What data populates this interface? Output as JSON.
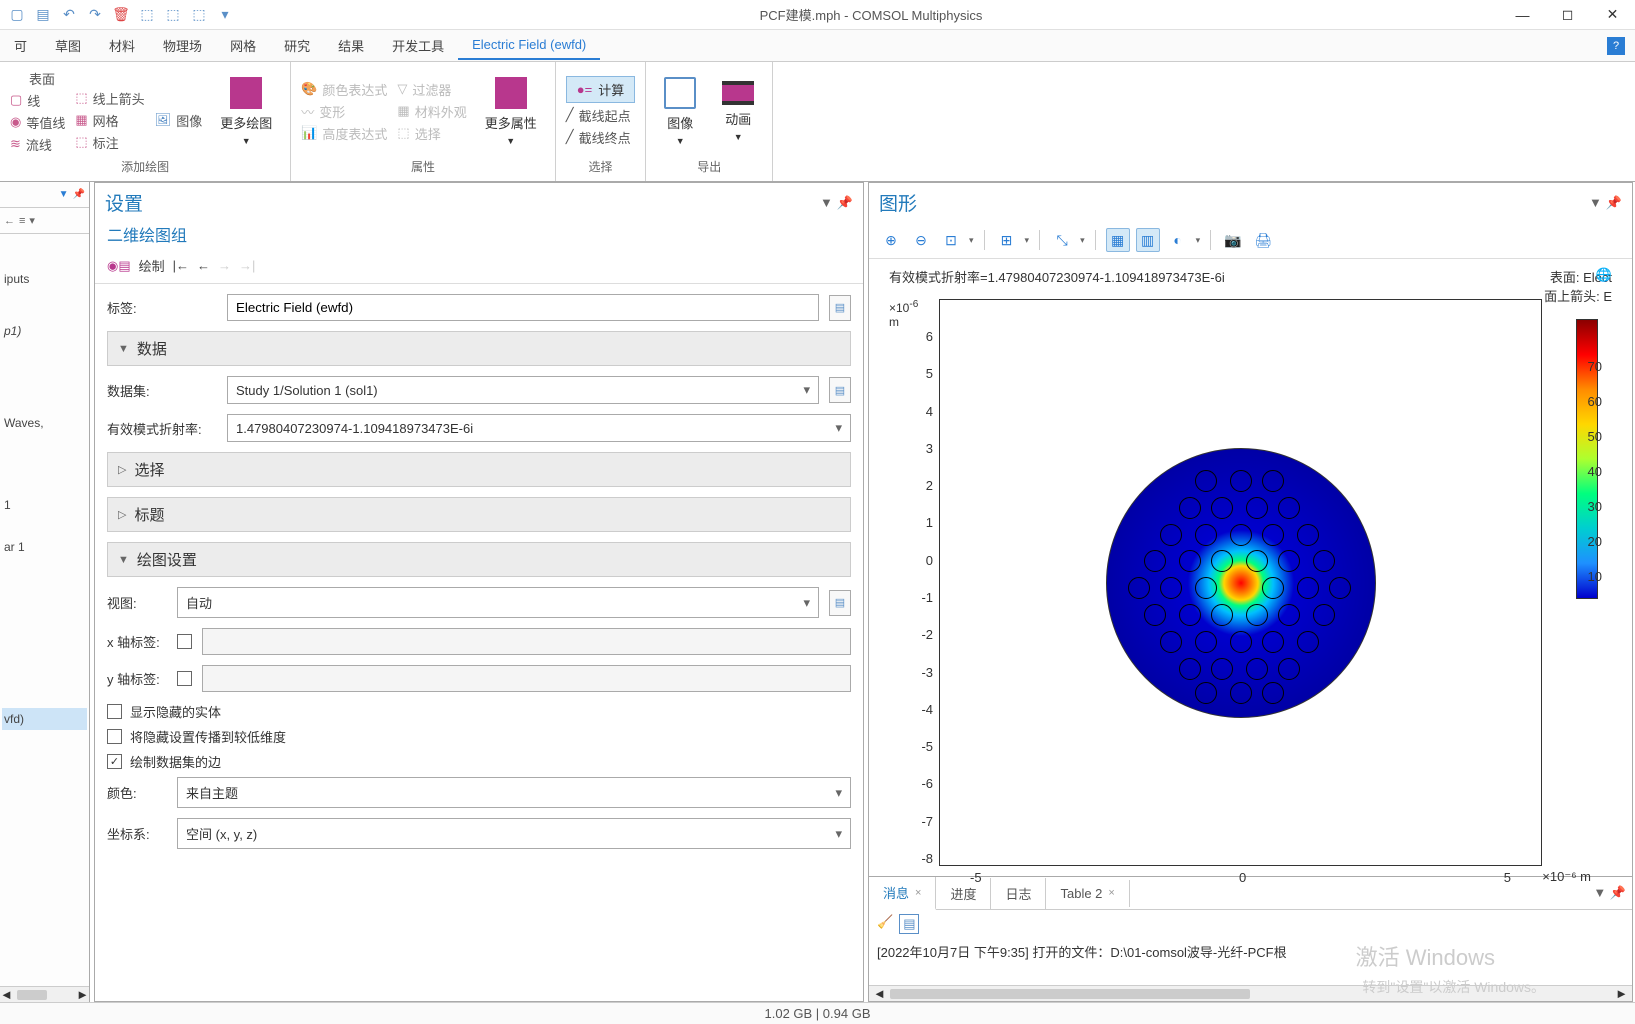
{
  "title": "PCF建模.mph - COMSOL Multiphysics",
  "menubar": [
    "可",
    "草图",
    "材料",
    "物理场",
    "网格",
    "研究",
    "结果",
    "开发工具",
    "Electric Field (ewfd)"
  ],
  "ribbon": {
    "group1": {
      "label": "添加绘图",
      "left": "表面",
      "items": [
        [
          "线",
          "线上箭头",
          "图像"
        ],
        [
          "等值线",
          "网格",
          ""
        ],
        [
          "流线",
          "标注",
          ""
        ]
      ],
      "big": "更多绘图"
    },
    "group2": {
      "label": "属性",
      "items": [
        [
          "颜色表达式",
          "过滤器"
        ],
        [
          "变形",
          "材料外观"
        ],
        [
          "高度表达式",
          "选择"
        ]
      ],
      "big": "更多属性"
    },
    "group3": {
      "label": "选择",
      "compute": "计算",
      "start": "截线起点",
      "end": "截线终点"
    },
    "group4": {
      "label": "导出",
      "img": "图像",
      "anim": "动画"
    }
  },
  "left_items": [
    "iputs",
    "p1)",
    "Waves,",
    "1",
    "ar 1",
    "vfd)"
  ],
  "settings": {
    "title": "设置",
    "subtitle": "二维绘图组",
    "plot_label": "绘制",
    "tag_label": "标签:",
    "tag_value": "Electric Field (ewfd)",
    "data_section": "数据",
    "dataset_label": "数据集:",
    "dataset_value": "Study 1/Solution 1 (sol1)",
    "refidx_label": "有效模式折射率:",
    "refidx_value": "1.47980407230974-1.109418973473E-6i",
    "select_section": "选择",
    "title_section": "标题",
    "plot_settings_section": "绘图设置",
    "view_label": "视图:",
    "view_value": "自动",
    "xlabel": "x 轴标签:",
    "ylabel": "y 轴标签:",
    "show_hidden": "显示隐藏的实体",
    "propagate": "将隐藏设置传播到较低维度",
    "plot_edges": "绘制数据集的边",
    "color_label": "颜色:",
    "color_value": "来自主题",
    "coord_label": "坐标系:",
    "coord_value": "空间 (x, y, z)"
  },
  "graphics": {
    "title": "图形",
    "info_left": "有效模式折射率=1.47980407230974-1.109418973473E-6i",
    "info_right1": "表面: Elect",
    "info_right2": "面上箭头: E",
    "y_unit_top": "×10",
    "y_unit_exp": "-6",
    "y_unit_m": "m",
    "x_unit": "×10⁻⁶ m"
  },
  "chart_data": {
    "type": "heatmap",
    "title": "有效模式折射率=1.47980407230974-1.109418973473E-6i",
    "xlabel": "×10⁻⁶ m",
    "ylabel": "×10⁻⁶ m",
    "x_ticks": [
      -5,
      0,
      5
    ],
    "y_ticks": [
      -8,
      -7,
      -6,
      -5,
      -4,
      -3,
      -2,
      -1,
      0,
      1,
      2,
      3,
      4,
      5,
      6
    ],
    "colorbar_ticks": [
      10,
      20,
      30,
      40,
      50,
      60,
      70
    ],
    "xlim": [
      -8,
      8
    ],
    "ylim": [
      -8,
      7
    ],
    "description": "Circular photonic crystal fiber cross-section with hexagonal array of air holes; electric field magnitude peaks at center (~75) and decays radially to ~0 at edges"
  },
  "bottom": {
    "tabs": [
      "消息",
      "进度",
      "日志",
      "Table 2"
    ],
    "message": "[2022年10月7日 下午9:35] 打开的文件：D:\\01-comsol波导-光纤-PCF根"
  },
  "status": "1.02 GB | 0.94 GB",
  "watermark": "激活 Windows",
  "watermark_sub": "转到\"设置\"以激活 Windows。"
}
